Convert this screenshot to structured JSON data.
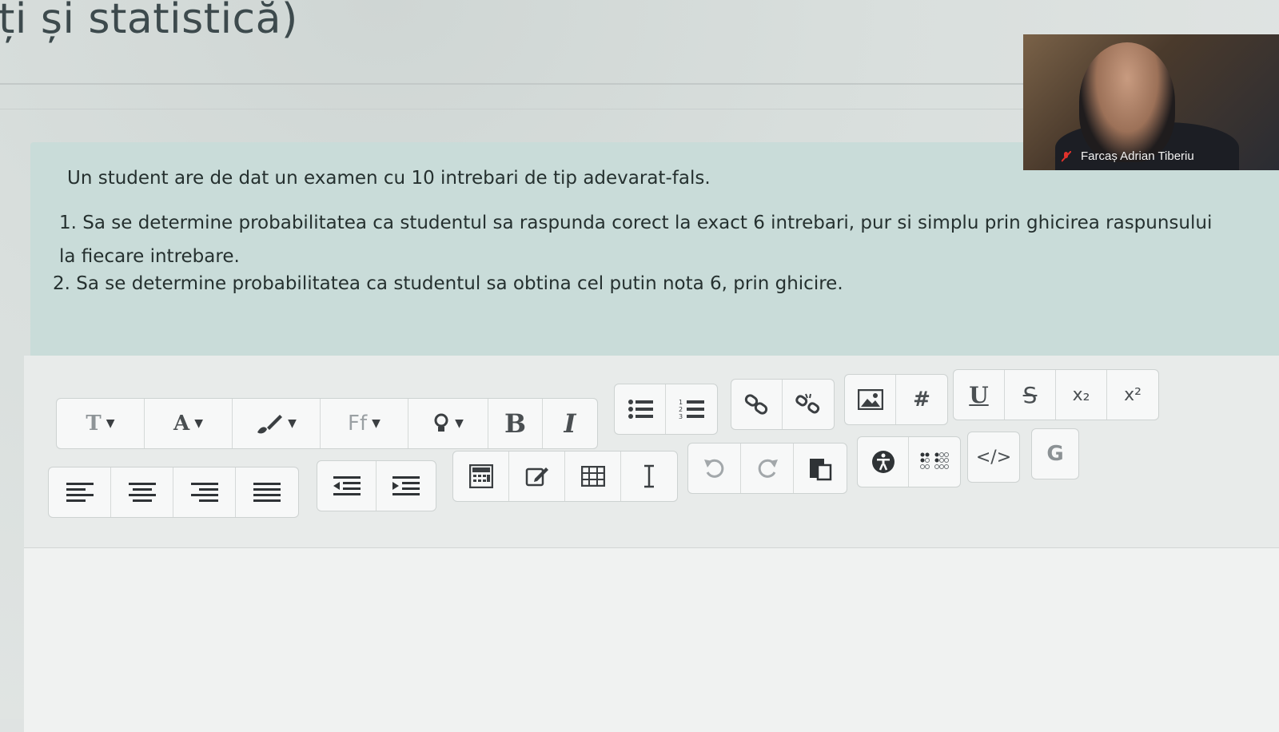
{
  "page": {
    "title": "ți și statistică)"
  },
  "question": {
    "intro": "Un student are de dat un examen cu 10 intrebari de tip adevarat-fals.",
    "items": [
      "1. Sa se determine probabilitatea ca studentul sa raspunda corect la exact 6 intrebari, pur si simplu prin ghicirea raspunsului la fiecare intrebare.",
      "2. Sa se determine probabilitatea ca studentul sa obtina cel putin nota 6, prin ghicire."
    ]
  },
  "toolbar": {
    "row1": [
      {
        "group": "format",
        "buttons": [
          {
            "name": "paragraph-style",
            "label": "T",
            "icon": "text-size-icon",
            "dropdown": true
          },
          {
            "name": "font-color",
            "label": "A",
            "icon": "font-color-icon",
            "dropdown": true
          },
          {
            "name": "background-color",
            "label": "",
            "icon": "paintbrush-icon",
            "dropdown": true
          },
          {
            "name": "font-family",
            "label": "Ff",
            "icon": "font-family-icon",
            "dropdown": true
          },
          {
            "name": "highlight",
            "label": "",
            "icon": "lightbulb-icon",
            "dropdown": true
          },
          {
            "name": "bold",
            "label": "B",
            "icon": "bold-icon"
          },
          {
            "name": "italic",
            "label": "I",
            "icon": "italic-icon"
          }
        ]
      },
      {
        "group": "lists",
        "buttons": [
          {
            "name": "unordered-list",
            "label": "",
            "icon": "bullet-list-icon"
          },
          {
            "name": "ordered-list",
            "label": "",
            "icon": "numbered-list-icon"
          }
        ]
      },
      {
        "group": "links",
        "buttons": [
          {
            "name": "link",
            "label": "",
            "icon": "link-icon"
          },
          {
            "name": "unlink",
            "label": "",
            "icon": "unlink-icon"
          }
        ]
      },
      {
        "group": "media",
        "buttons": [
          {
            "name": "image",
            "label": "",
            "icon": "image-icon"
          },
          {
            "name": "hashtag",
            "label": "#",
            "icon": "hashtag-icon"
          }
        ]
      },
      {
        "group": "textstyle",
        "buttons": [
          {
            "name": "underline",
            "label": "U",
            "icon": "underline-icon"
          },
          {
            "name": "strikethrough",
            "label": "S",
            "icon": "strikethrough-icon"
          },
          {
            "name": "subscript",
            "label": "x₂",
            "icon": "subscript-icon"
          },
          {
            "name": "superscript",
            "label": "x²",
            "icon": "superscript-icon"
          }
        ]
      }
    ],
    "row2": [
      {
        "group": "align",
        "buttons": [
          {
            "name": "align-left",
            "icon": "align-left-icon"
          },
          {
            "name": "align-center",
            "icon": "align-center-icon"
          },
          {
            "name": "align-right",
            "icon": "align-right-icon"
          },
          {
            "name": "align-justify",
            "icon": "align-justify-icon"
          }
        ]
      },
      {
        "group": "indent",
        "buttons": [
          {
            "name": "outdent",
            "icon": "outdent-icon"
          },
          {
            "name": "indent",
            "icon": "indent-icon"
          }
        ]
      },
      {
        "group": "insert",
        "buttons": [
          {
            "name": "calculator",
            "icon": "calculator-icon"
          },
          {
            "name": "edit",
            "icon": "edit-icon"
          },
          {
            "name": "table",
            "icon": "table-icon"
          },
          {
            "name": "cursor",
            "icon": "text-cursor-icon"
          }
        ]
      },
      {
        "group": "history",
        "buttons": [
          {
            "name": "undo",
            "icon": "undo-icon"
          },
          {
            "name": "redo",
            "icon": "redo-icon"
          },
          {
            "name": "paste",
            "icon": "paste-icon"
          }
        ]
      },
      {
        "group": "accessibility",
        "buttons": [
          {
            "name": "accessibility-checker",
            "icon": "accessibility-icon"
          },
          {
            "name": "screen-reader",
            "icon": "braille-icon"
          }
        ]
      },
      {
        "group": "source",
        "buttons": [
          {
            "name": "html-source",
            "label": "</>",
            "icon": "code-icon"
          }
        ]
      },
      {
        "group": "extra",
        "buttons": [
          {
            "name": "g-plugin",
            "label": "G",
            "icon": "g-icon"
          }
        ]
      }
    ]
  },
  "webcam": {
    "participant_name": "Farcaș Adrian Tiberiu",
    "mic_status": "muted",
    "mute_color": "#e0322c"
  }
}
